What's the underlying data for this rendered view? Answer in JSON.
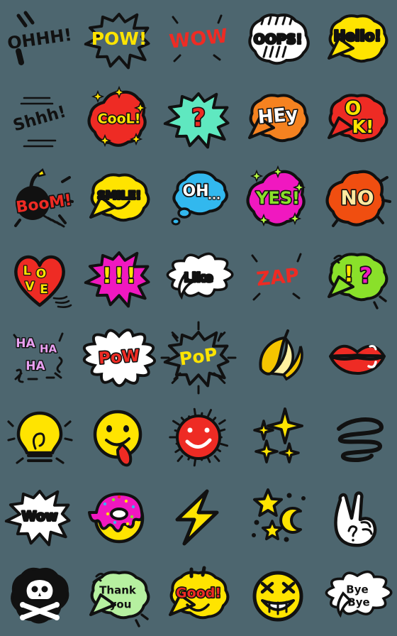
{
  "page": {
    "background_color": "#4d666f",
    "grid_columns": 5,
    "grid_rows": 8,
    "sticker_count": 40,
    "title": "Doodle Comic Sticker Set"
  },
  "palette": {
    "ink": "#111111",
    "white": "#ffffff",
    "yellow": "#ffe400",
    "red": "#ee2b24",
    "orange": "#f58220",
    "pink": "#f018c0",
    "magenta": "#e83fd0",
    "cyan": "#32b8ee",
    "mint": "#5fe8c0",
    "green": "#8ae02a",
    "lightgreen": "#b6f0a0",
    "gold": "#f5c400",
    "lavender": "#e8a0f0"
  },
  "stickers": [
    {
      "id": "ohhh",
      "label": "OHHH!",
      "row": 1,
      "col": 1,
      "shape": "text-only",
      "text": "OHHH!",
      "text_color": "#111111",
      "fill": "none",
      "outline": "#111111"
    },
    {
      "id": "pow-yellow",
      "label": "POW!",
      "row": 1,
      "col": 2,
      "shape": "burst-spiky",
      "text": "POW!",
      "text_color": "#ffe400",
      "fill": "none",
      "outline": "#111111"
    },
    {
      "id": "wow-red",
      "label": "WOW",
      "row": 1,
      "col": 3,
      "shape": "text-only",
      "text": "WOW",
      "text_color": "#ee2b24",
      "fill": "none",
      "outline": "#111111"
    },
    {
      "id": "oops",
      "label": "OOPS!",
      "row": 1,
      "col": 4,
      "shape": "bubble-round",
      "text": "OOPS!",
      "text_color": "#111111",
      "fill": "#ffffff",
      "outline": "#111111"
    },
    {
      "id": "hello",
      "label": "Hello!",
      "row": 1,
      "col": 5,
      "shape": "bubble-speech",
      "text": "Hello!",
      "text_color": "#111111",
      "fill": "#ffe400",
      "outline": "#111111"
    },
    {
      "id": "shhh",
      "label": "Shhhh!",
      "row": 2,
      "col": 1,
      "shape": "text-only",
      "text": "Shhh!",
      "text_color": "#111111",
      "fill": "none",
      "outline": "#111111"
    },
    {
      "id": "cool",
      "label": "CooL!",
      "row": 2,
      "col": 2,
      "shape": "bubble-blob",
      "text": "CooL!",
      "text_color": "#ffe400",
      "fill": "#ee2b24",
      "outline": "#111111"
    },
    {
      "id": "question",
      "label": "?",
      "row": 2,
      "col": 3,
      "shape": "burst-spiky",
      "text": "?",
      "text_color": "#ee2b24",
      "fill": "#5fe8c0",
      "outline": "#111111"
    },
    {
      "id": "hey",
      "label": "HEy",
      "row": 2,
      "col": 4,
      "shape": "bubble-speech",
      "text": "HEy",
      "text_color": "#ffffff",
      "fill": "#f58220",
      "outline": "#111111"
    },
    {
      "id": "ok",
      "label": "OK!",
      "row": 2,
      "col": 5,
      "shape": "bubble-speech",
      "text": "OK!",
      "text_color": "#ffe400",
      "fill": "#ee2b24",
      "outline": "#111111"
    },
    {
      "id": "boom",
      "label": "BooM!",
      "row": 3,
      "col": 1,
      "shape": "bomb",
      "text": "BooM!",
      "text_color": "#ee2b24",
      "fill": "#111111",
      "outline": "#111111"
    },
    {
      "id": "smile",
      "label": "SMILE!",
      "row": 3,
      "col": 2,
      "shape": "bubble-speech",
      "text": "SMILE!",
      "text_color": "#111111",
      "fill": "#ffe400",
      "outline": "#111111"
    },
    {
      "id": "oh",
      "label": "OH...",
      "row": 3,
      "col": 3,
      "shape": "bubble-thought",
      "text": "OH...",
      "text_color": "#ffffff",
      "fill": "#32b8ee",
      "outline": "#111111"
    },
    {
      "id": "yes",
      "label": "YES!",
      "row": 3,
      "col": 4,
      "shape": "bubble-blob",
      "text": "YES!",
      "text_color": "#8ae02a",
      "fill": "#f018c0",
      "outline": "#111111"
    },
    {
      "id": "no",
      "label": "NO",
      "row": 3,
      "col": 5,
      "shape": "bubble-blob",
      "text": "NO",
      "text_color": "#ffe9a0",
      "fill": "#f04e10",
      "outline": "#111111"
    },
    {
      "id": "love",
      "label": "LOVE",
      "row": 4,
      "col": 1,
      "shape": "heart",
      "text": "LOVE",
      "text_color": "#ffe400",
      "fill": "#ee2b24",
      "outline": "#111111"
    },
    {
      "id": "exclaim3",
      "label": "!!!",
      "row": 4,
      "col": 2,
      "shape": "burst-spiky",
      "text": "!!!",
      "text_color": "#ffe400",
      "fill": "#f018c0",
      "outline": "#111111"
    },
    {
      "id": "like",
      "label": "Like",
      "row": 4,
      "col": 3,
      "shape": "bubble-cloud",
      "text": "Like",
      "text_color": "#111111",
      "fill": "#ffffff",
      "outline": "#111111"
    },
    {
      "id": "zap-red",
      "label": "ZAP",
      "row": 4,
      "col": 4,
      "shape": "text-only",
      "text": "ZAP",
      "text_color": "#ee2b24",
      "fill": "none",
      "outline": "#111111"
    },
    {
      "id": "interrobang",
      "label": "!?",
      "row": 4,
      "col": 5,
      "shape": "bubble-speech",
      "text": "!?",
      "text_color": "#ffe400",
      "fill": "#8ae02a",
      "outline": "#111111"
    },
    {
      "id": "hahaha",
      "label": "HA HA HA",
      "row": 5,
      "col": 1,
      "shape": "text-only",
      "text": "HA HA",
      "text_color": "#e8a0f0",
      "fill": "none",
      "outline": "#111111"
    },
    {
      "id": "pow-white",
      "label": "PoW",
      "row": 5,
      "col": 2,
      "shape": "burst-cloud",
      "text": "PoW",
      "text_color": "#ee2b24",
      "fill": "#ffffff",
      "outline": "#111111"
    },
    {
      "id": "pop",
      "label": "PoP",
      "row": 5,
      "col": 3,
      "shape": "burst-spiky",
      "text": "PoP",
      "text_color": "#ffe400",
      "fill": "none",
      "outline": "#ee2b24"
    },
    {
      "id": "banana",
      "label": "banana",
      "row": 5,
      "col": 4,
      "shape": "banana",
      "text": "",
      "text_color": "#111111",
      "fill": "#f5c400",
      "outline": "#111111"
    },
    {
      "id": "lips",
      "label": "lips",
      "row": 5,
      "col": 5,
      "shape": "lips",
      "text": "",
      "text_color": "#111111",
      "fill": "#ee2b24",
      "outline": "#111111"
    },
    {
      "id": "lightbulb",
      "label": "idea bulb",
      "row": 6,
      "col": 1,
      "shape": "bulb",
      "text": "",
      "text_color": "#111111",
      "fill": "#ffe400",
      "outline": "#111111"
    },
    {
      "id": "tongue-face",
      "label": "tongue face",
      "row": 6,
      "col": 2,
      "shape": "face-tongue",
      "text": "",
      "text_color": "#111111",
      "fill": "#ffe400",
      "outline": "#111111"
    },
    {
      "id": "red-spiky-face",
      "label": "angry spiky face",
      "row": 6,
      "col": 3,
      "shape": "face-spiky",
      "text": "",
      "text_color": "#ffffff",
      "fill": "#ee2b24",
      "outline": "#111111"
    },
    {
      "id": "sparkles",
      "label": "sparkles",
      "row": 6,
      "col": 4,
      "shape": "sparkles",
      "text": "",
      "text_color": "#111111",
      "fill": "#ffe400",
      "outline": "#111111"
    },
    {
      "id": "scribble",
      "label": "scribble",
      "row": 6,
      "col": 5,
      "shape": "scribble",
      "text": "",
      "text_color": "#111111",
      "fill": "none",
      "outline": "#111111"
    },
    {
      "id": "wow-white",
      "label": "Wow",
      "row": 7,
      "col": 1,
      "shape": "burst-spiky",
      "text": "Wow",
      "text_color": "#111111",
      "fill": "#ffffff",
      "outline": "#111111"
    },
    {
      "id": "donut",
      "label": "donut",
      "row": 7,
      "col": 2,
      "shape": "donut",
      "text": "",
      "text_color": "#111111",
      "fill": "#f018c0",
      "outline": "#111111"
    },
    {
      "id": "bolt",
      "label": "lightning bolt",
      "row": 7,
      "col": 3,
      "shape": "bolt",
      "text": "",
      "text_color": "#111111",
      "fill": "#ffe400",
      "outline": "#111111"
    },
    {
      "id": "star-moon",
      "label": "stars and moon",
      "row": 7,
      "col": 4,
      "shape": "star-moon",
      "text": "",
      "text_color": "#111111",
      "fill": "#ffe400",
      "outline": "#111111"
    },
    {
      "id": "peace-hand",
      "label": "peace hand",
      "row": 7,
      "col": 5,
      "shape": "hand-peace",
      "text": "",
      "text_color": "#111111",
      "fill": "#ffffff",
      "outline": "#111111"
    },
    {
      "id": "skull",
      "label": "skull and crossbones",
      "row": 8,
      "col": 1,
      "shape": "skull",
      "text": "",
      "text_color": "#ffffff",
      "fill": "#111111",
      "outline": "#111111"
    },
    {
      "id": "thankyou",
      "label": "Thank you",
      "row": 8,
      "col": 2,
      "shape": "bubble-speech",
      "text": "Thank you",
      "text_color": "#111111",
      "fill": "#b6f0a0",
      "outline": "#111111"
    },
    {
      "id": "good",
      "label": "Good!",
      "row": 8,
      "col": 3,
      "shape": "bubble-speech",
      "text": "Good!",
      "text_color": "#ee2b24",
      "fill": "#ffe400",
      "outline": "#111111"
    },
    {
      "id": "grin-face",
      "label": "grinning face",
      "row": 8,
      "col": 4,
      "shape": "face-grin",
      "text": "",
      "text_color": "#111111",
      "fill": "#ffe400",
      "outline": "#111111"
    },
    {
      "id": "byebye",
      "label": "Bye Bye",
      "row": 8,
      "col": 5,
      "shape": "bubble-cloud",
      "text": "Bye Bye",
      "text_color": "#111111",
      "fill": "#ffffff",
      "outline": "#111111"
    }
  ]
}
